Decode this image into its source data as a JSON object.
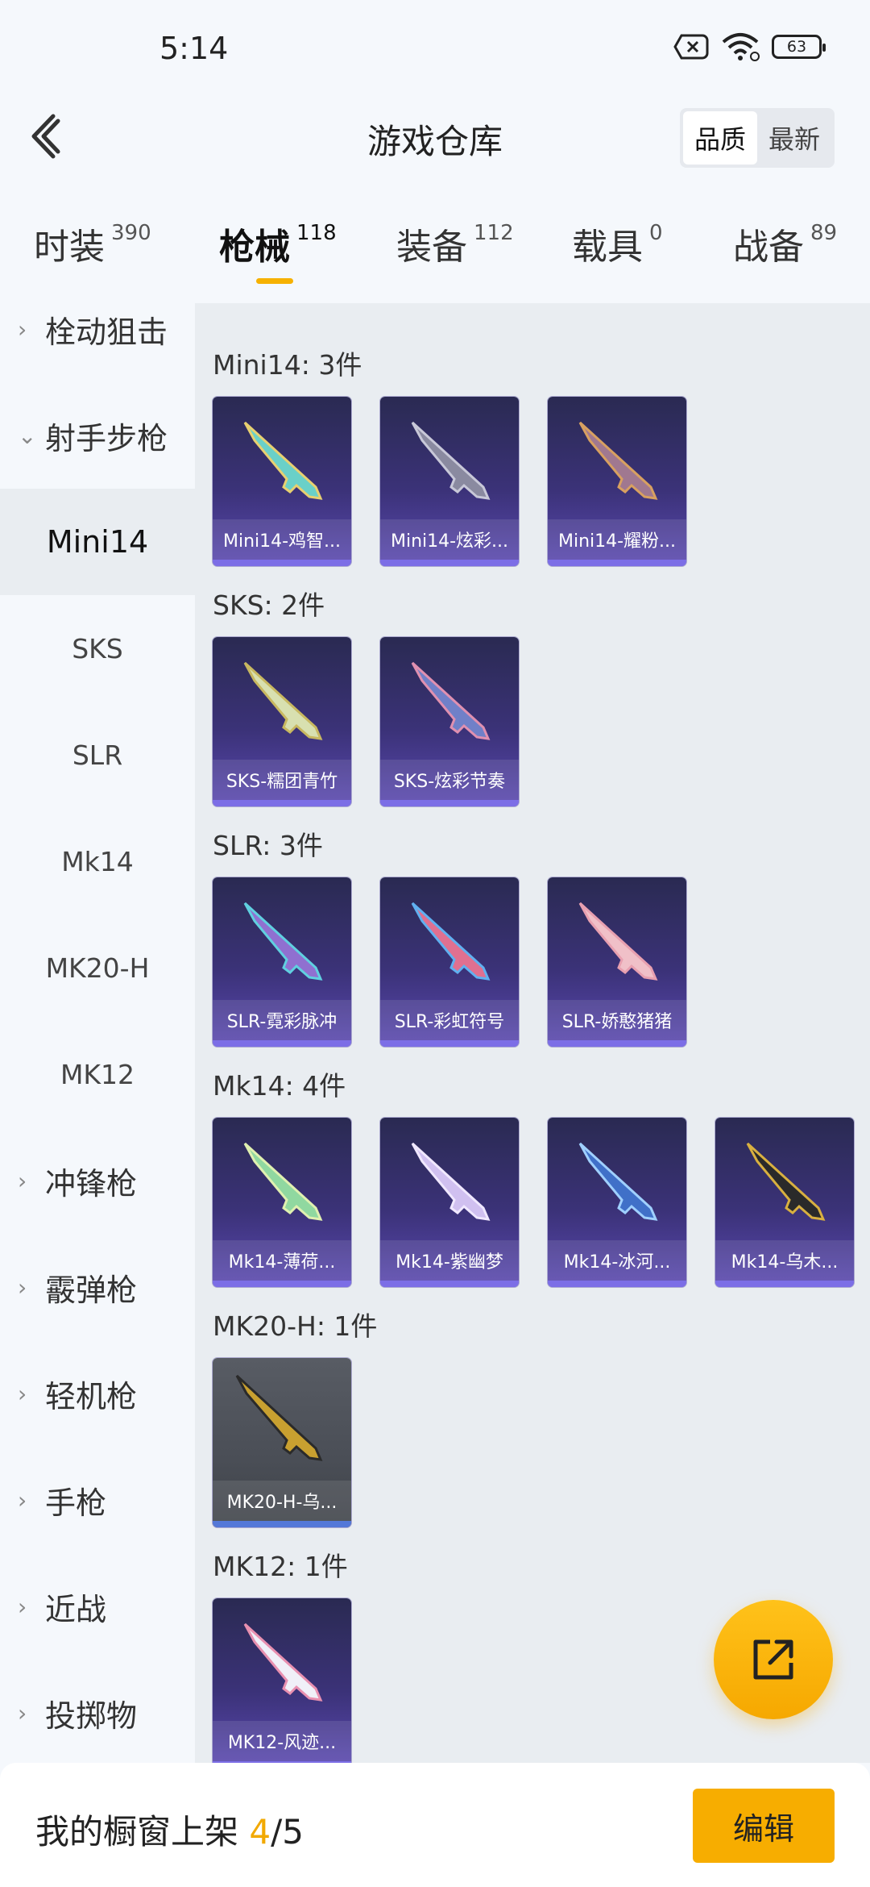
{
  "status": {
    "time": "5:14",
    "battery": "63"
  },
  "header": {
    "title": "游戏仓库",
    "sort_quality": "品质",
    "sort_latest": "最新"
  },
  "tabs": [
    {
      "label": "时装",
      "count": "390"
    },
    {
      "label": "枪械",
      "count": "118"
    },
    {
      "label": "装备",
      "count": "112"
    },
    {
      "label": "载具",
      "count": "0"
    },
    {
      "label": "战备",
      "count": "89"
    }
  ],
  "sidebar": {
    "groups_top": [
      "栓动狙击",
      "射手步枪"
    ],
    "subs": [
      "Mini14",
      "SKS",
      "SLR",
      "Mk14",
      "MK20-H",
      "MK12"
    ],
    "groups_bottom": [
      "冲锋枪",
      "霰弹枪",
      "轻机枪",
      "手枪",
      "近战",
      "投掷物"
    ]
  },
  "sections": [
    {
      "title": "Mini14: 3件",
      "items": [
        "Mini14-鸡智...",
        "Mini14-炫彩...",
        "Mini14-耀粉..."
      ]
    },
    {
      "title": "SKS: 2件",
      "items": [
        "SKS-糯团青竹",
        "SKS-炫彩节奏"
      ]
    },
    {
      "title": "SLR: 3件",
      "items": [
        "SLR-霓彩脉冲",
        "SLR-彩虹符号",
        "SLR-娇憨猪猪"
      ]
    },
    {
      "title": "Mk14: 4件",
      "items": [
        "Mk14-薄荷...",
        "Mk14-紫幽梦",
        "Mk14-冰河...",
        "Mk14-乌木..."
      ]
    },
    {
      "title": "MK20-H: 1件",
      "items": [
        "MK20-H-乌..."
      ]
    },
    {
      "title": "MK12: 1件",
      "items": [
        "MK12-风迹..."
      ]
    }
  ],
  "bottom": {
    "showcase_label": "我的橱窗上架",
    "showcase_count": "4",
    "showcase_total": "/5",
    "edit_label": "编辑"
  }
}
